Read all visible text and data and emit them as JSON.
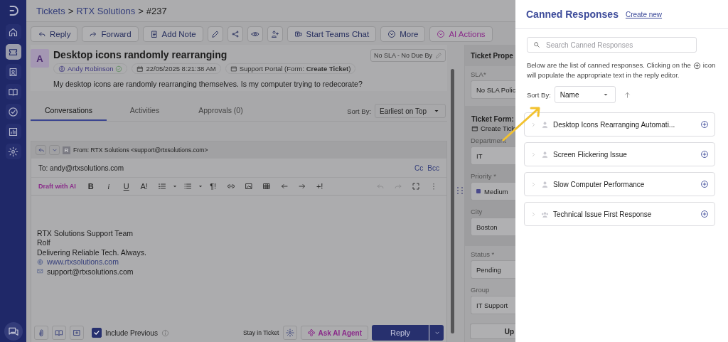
{
  "sidebar": {
    "items": [
      {
        "kind": "home",
        "selected": false
      },
      {
        "kind": "ticket",
        "selected": true
      },
      {
        "kind": "contact",
        "selected": false
      },
      {
        "kind": "book",
        "selected": false
      },
      {
        "kind": "check",
        "selected": false
      },
      {
        "kind": "chart",
        "selected": false
      },
      {
        "kind": "gear",
        "selected": false
      }
    ]
  },
  "breadcrumb": {
    "separator": ">",
    "items": [
      {
        "label": "Tickets",
        "link": true
      },
      {
        "label": "RTX Solutions",
        "link": true
      },
      {
        "label": "#237",
        "link": false
      }
    ]
  },
  "toolbar": [
    {
      "kind": "reply",
      "label": "Reply"
    },
    {
      "kind": "forward",
      "label": "Forward"
    },
    {
      "kind": "note",
      "label": "Add Note"
    },
    {
      "kind": "edit"
    },
    {
      "kind": "share"
    },
    {
      "kind": "eye"
    },
    {
      "kind": "add-user"
    },
    {
      "kind": "teams",
      "label": "Start Teams Chat"
    },
    {
      "kind": "more",
      "label": "More"
    },
    {
      "kind": "ai",
      "label": "AI Actions"
    }
  ],
  "ticket": {
    "avatar": "A",
    "title": "Desktop icons randomly rearranging",
    "requester": "Andy Robinson",
    "date": "22/05/2025 8:21:38 AM",
    "source": "Support Portal (Form: **Create Ticket**)",
    "sla": "No SLA - No Due By",
    "description": "My desktop icons are randomly rearranging themselves. Is my computer trying to redecorate?"
  },
  "tabs": [
    {
      "label": "Conversations",
      "selected": true
    },
    {
      "label": "Activities",
      "selected": false
    },
    {
      "label": "Approvals (0)",
      "selected": false
    }
  ],
  "sort": {
    "label": "Sort By:",
    "value": "Earliest on Top"
  },
  "composer": {
    "from_avatar": "R",
    "from": "From:  RTX Solutions <support@rtxsolutions.com>",
    "to": "To: andy@rtxsolutions.com",
    "cc": "Cc",
    "bcc": "Bcc",
    "draft_ai": "Draft with AI",
    "tools": [
      {
        "kind": "bold",
        "text": "B"
      },
      {
        "kind": "italic",
        "text": "i"
      },
      {
        "kind": "underline",
        "text": "U"
      },
      {
        "kind": "size",
        "text": "A!"
      },
      {
        "kind": "ordered-list"
      },
      {
        "kind": "caret"
      },
      {
        "kind": "bullet-list"
      },
      {
        "kind": "caret"
      },
      {
        "kind": "paragraph",
        "text": "¶!"
      },
      {
        "kind": "link"
      },
      {
        "kind": "image"
      },
      {
        "kind": "table"
      },
      {
        "kind": "left"
      },
      {
        "kind": "right"
      },
      {
        "kind": "insert",
        "text": "+!"
      }
    ],
    "tools_end": [
      {
        "kind": "undo"
      },
      {
        "kind": "redo"
      },
      {
        "kind": "fullscreen"
      },
      {
        "kind": "dots"
      }
    ],
    "signature": [
      {
        "kind": "plain",
        "text": "RTX Solutions Support Team"
      },
      {
        "kind": "plain",
        "text": "Rolf"
      },
      {
        "kind": "plain",
        "text": "Delivering Reliable Tech. Always."
      },
      {
        "kind": "web",
        "text": "www.rtxsolutions.com"
      },
      {
        "kind": "email",
        "text": "support@rtxsolutions.com"
      }
    ],
    "include_previous": {
      "label": "Include Previous",
      "checked": true
    },
    "stay": "Stay in Ticket",
    "ask_ai": "Ask AI Agent",
    "reply": "Reply"
  },
  "properties": {
    "title": "Ticket Prope",
    "sla": {
      "label": "SLA*",
      "value": "No SLA Polic"
    },
    "form": {
      "label": "Ticket Form:",
      "value": "Create Tick",
      "fields": [
        {
          "label": "Department",
          "value": "IT"
        },
        {
          "label": "Priority *",
          "value": "Medium",
          "color": "#4a4a8c"
        },
        {
          "label": "City",
          "value": "Boston"
        }
      ]
    },
    "fields": [
      {
        "label": "Status *",
        "value": "Pending"
      },
      {
        "label": "Group",
        "value": "IT Support"
      }
    ],
    "button": "Up"
  },
  "canned": {
    "title": "Canned Responses",
    "create_new": "Create new",
    "search_placeholder": "Search Canned Responses",
    "info_before": "Below are the list of canned responses. Clicking on the",
    "info_after": "icon",
    "info_line2": "will populate the appropriate text in the reply editor.",
    "sort_label": "Sort By:",
    "sort_value": "Name",
    "items": [
      {
        "kind": "personal",
        "title": "Desktop Icons Rearranging Automati..."
      },
      {
        "kind": "personal",
        "title": "Screen Flickering Issue"
      },
      {
        "kind": "personal",
        "title": "Slow Computer Performance"
      },
      {
        "kind": "shared",
        "title": "Technical Issue First Response"
      }
    ]
  }
}
